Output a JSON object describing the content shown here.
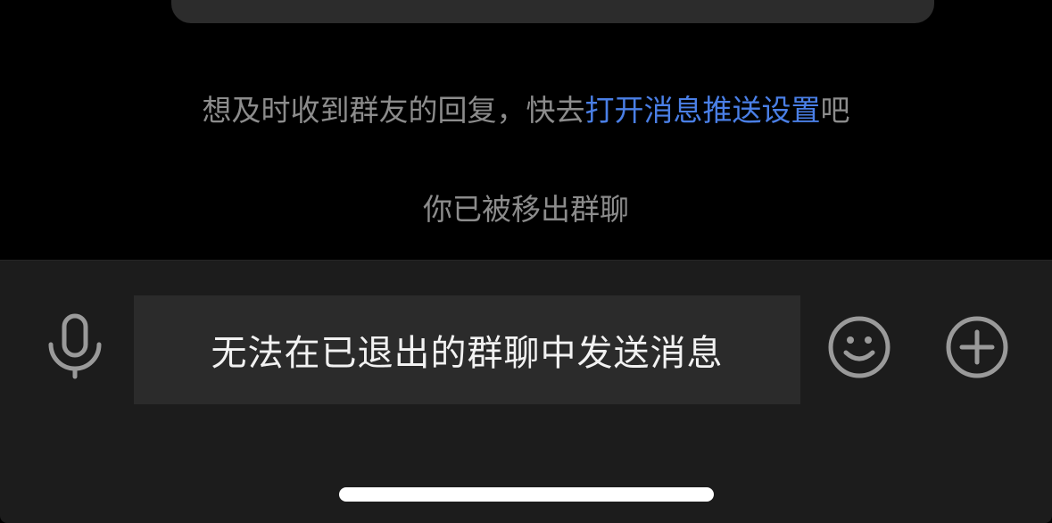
{
  "chat": {
    "push_prompt": {
      "prefix": "想及时收到群友的回复，快去",
      "link": "打开消息推送设置",
      "suffix": "吧"
    },
    "removed_notice": "你已被移出群聊"
  },
  "input_bar": {
    "message_placeholder": "无法在已退出的群聊中发送消息",
    "left_icon": "microphone-icon",
    "right_icons": [
      "smiley-icon",
      "plus-circle-icon"
    ]
  },
  "colors": {
    "background": "#000000",
    "bar_background": "#1c1c1c",
    "input_background": "#2b2b2b",
    "link": "#4a7fe6",
    "muted_text": "#8c8c8c",
    "icon": "#9a9a9a"
  }
}
